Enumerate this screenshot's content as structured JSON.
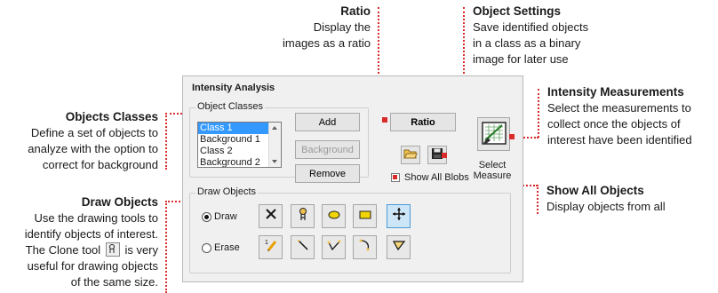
{
  "annotations": {
    "ratio": {
      "title": "Ratio",
      "lines": [
        "Display the",
        "images as a ratio"
      ]
    },
    "object_settings": {
      "title": "Object Settings",
      "lines": [
        "Save identified objects",
        "in a class as a binary",
        "image for later use"
      ]
    },
    "intensity_measurements": {
      "title": "Intensity Measurements",
      "lines": [
        "Select the measurements to",
        "collect once the objects of",
        "interest have been identified"
      ]
    },
    "objects_classes": {
      "title": "Objects Classes",
      "lines": [
        "Define a set of objects to",
        "analyze with the option to",
        "correct for background"
      ]
    },
    "draw_objects": {
      "title": "Draw  Objects",
      "lines": [
        "Use the drawing tools to",
        "identify objects of interest.",
        "The Clone tool",
        "is very",
        "useful for drawing objects",
        "of the same size."
      ]
    },
    "show_all_objects": {
      "title": "Show All Objects",
      "lines": [
        "Display objects from all"
      ]
    }
  },
  "dialog": {
    "title": "Intensity Analysis",
    "object_classes": {
      "group_label": "Object Classes",
      "items": [
        "Class 1",
        "Background 1",
        "Class 2",
        "Background 2"
      ],
      "selected_index": 0,
      "add_label": "Add",
      "background_label": "Background",
      "remove_label": "Remove"
    },
    "ratio_label": "Ratio",
    "show_all_blobs_label": "Show All Blobs",
    "select_measure_label": [
      "Select",
      "Measure"
    ],
    "draw_objects": {
      "group_label": "Draw Objects",
      "draw_label": "Draw",
      "erase_label": "Erase",
      "mode": "Draw"
    }
  },
  "colors": {
    "annotation_dots": "#d92b2b",
    "selection": "#3399ff",
    "active_tool": "#cde6f7"
  },
  "icons": {
    "draw_row": [
      "delete-x-icon",
      "clone-tool-icon",
      "ellipse-tool-icon",
      "rectangle-tool-icon",
      "move-tool-icon"
    ],
    "erase_row": [
      "pencil-number-icon",
      "line-tool-icon",
      "polyline-tool-icon",
      "freehand-tool-icon",
      "polygon-tool-icon"
    ]
  }
}
